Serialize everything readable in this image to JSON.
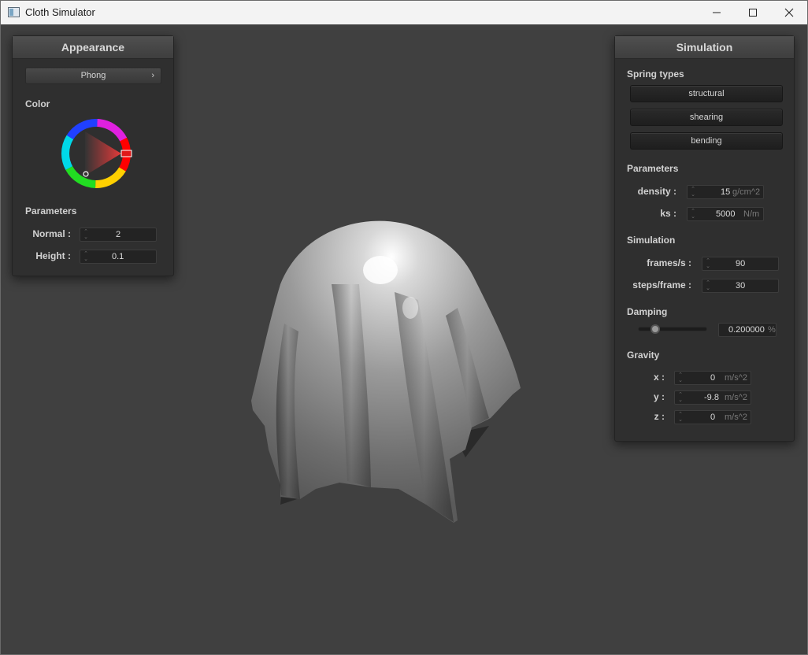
{
  "window": {
    "title": "Cloth Simulator",
    "icon": "app-window-icon"
  },
  "appearance": {
    "title": "Appearance",
    "shader": "Phong",
    "color_label": "Color",
    "color_value": "#e01818",
    "parameters_label": "Parameters",
    "normal": {
      "label": "Normal :",
      "value": "2"
    },
    "height": {
      "label": "Height :",
      "value": "0.1"
    }
  },
  "simulation": {
    "title": "Simulation",
    "spring_types_label": "Spring types",
    "spring_types": [
      "structural",
      "shearing",
      "bending"
    ],
    "parameters_label": "Parameters",
    "density": {
      "label": "density :",
      "value": "15",
      "unit": "g/cm^2"
    },
    "ks": {
      "label": "ks :",
      "value": "5000",
      "unit": "N/m"
    },
    "simulation_label": "Simulation",
    "frames": {
      "label": "frames/s :",
      "value": "90"
    },
    "steps": {
      "label": "steps/frame :",
      "value": "30"
    },
    "damping_label": "Damping",
    "damping": {
      "value": "0.200000",
      "unit": "%",
      "slider_fraction": 0.2
    },
    "gravity_label": "Gravity",
    "gravity": [
      {
        "label": "x :",
        "value": "0",
        "unit": "m/s^2"
      },
      {
        "label": "y :",
        "value": "-9.8",
        "unit": "m/s^2"
      },
      {
        "label": "z :",
        "value": "0",
        "unit": "m/s^2"
      }
    ]
  }
}
